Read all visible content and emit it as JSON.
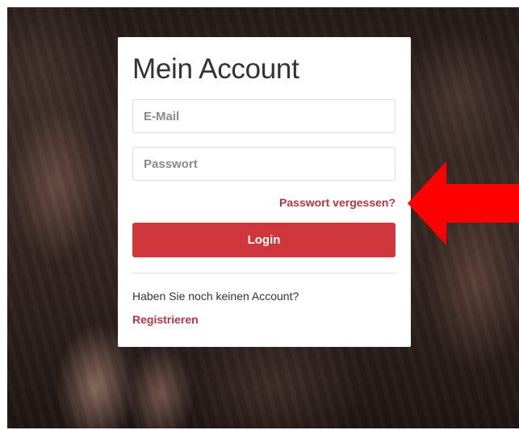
{
  "login_card": {
    "title": "Mein Account",
    "email_placeholder": "E-Mail",
    "password_placeholder": "Passwort",
    "forgot_password_label": "Passwort vergessen?",
    "login_button_label": "Login",
    "no_account_text": "Haben Sie noch keinen Account?",
    "register_label": "Registrieren"
  },
  "colors": {
    "accent": "#d0373d",
    "link": "#b5363c",
    "annotation_arrow": "#ff0000"
  },
  "annotation": {
    "icon": "red-arrow-left-icon"
  }
}
